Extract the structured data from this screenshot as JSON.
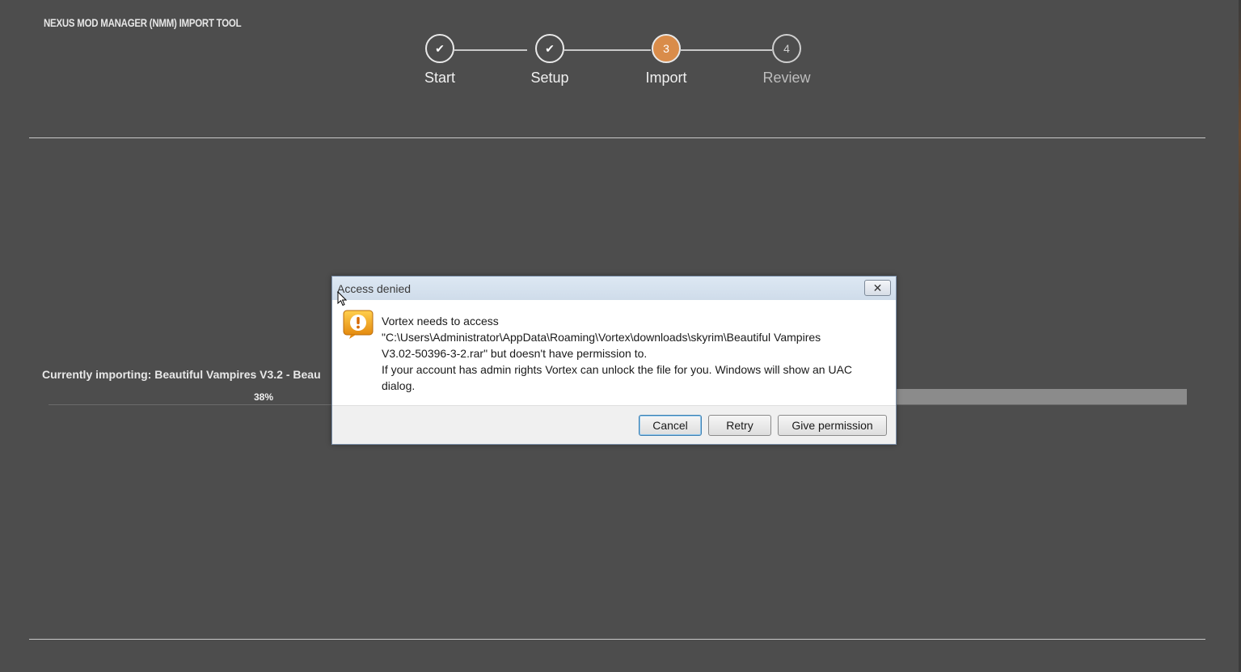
{
  "app": {
    "title": "NEXUS MOD MANAGER (NMM) IMPORT TOOL"
  },
  "stepper": {
    "steps": [
      {
        "label": "Start",
        "state": "done",
        "marker": "✔"
      },
      {
        "label": "Setup",
        "state": "done",
        "marker": "✔"
      },
      {
        "label": "Import",
        "state": "active",
        "marker": "3"
      },
      {
        "label": "Review",
        "state": "pending",
        "marker": "4"
      }
    ]
  },
  "import": {
    "status_text": "Currently importing: Beautiful Vampires V3.2 - Beau",
    "progress_percent": 38,
    "progress_label": "38%"
  },
  "dialog": {
    "title": "Access denied",
    "close_icon": "close-icon",
    "icon": "warning-icon",
    "message_lines": [
      "Vortex needs to access",
      "\"C:\\Users\\Administrator\\AppData\\Roaming\\Vortex\\downloads\\skyrim\\Beautiful Vampires",
      "V3.02-50396-3-2.rar\" but doesn't have permission to.",
      "If your account has admin rights Vortex can unlock the file for you. Windows will show an UAC",
      "dialog."
    ],
    "buttons": {
      "cancel": "Cancel",
      "retry": "Retry",
      "give_permission": "Give permission"
    }
  },
  "colors": {
    "background": "#4d4d4d",
    "accent": "#d98c4a",
    "dialog_title_bar": "#dde8f3"
  }
}
